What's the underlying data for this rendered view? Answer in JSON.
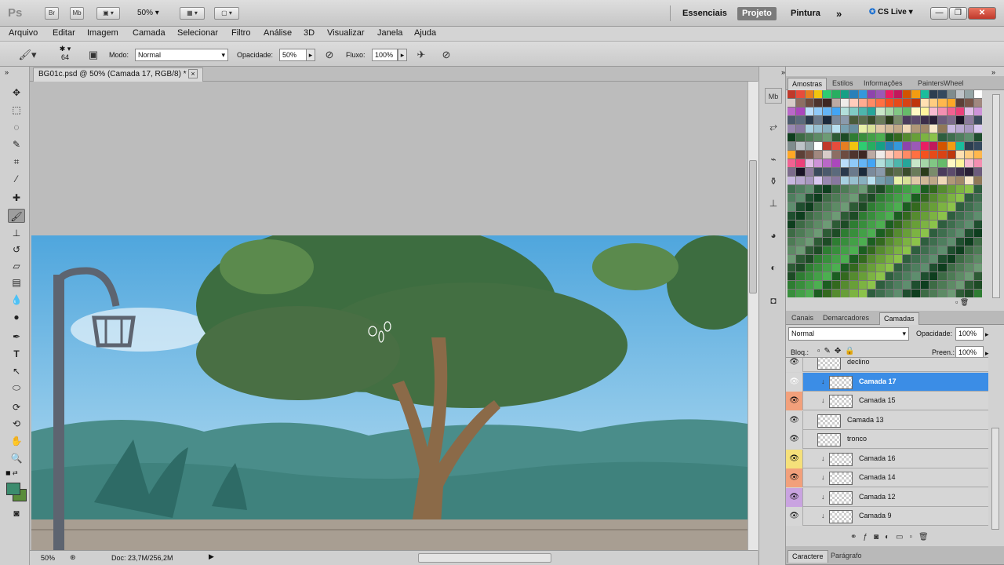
{
  "app": {
    "logo": "Ps",
    "br": "Br",
    "mb": "Mb",
    "zoom": "50%",
    "workspaces": [
      "Essenciais",
      "Projeto",
      "Pintura"
    ],
    "active_workspace": "Projeto",
    "more": "»",
    "cs_live": "CS Live"
  },
  "menu": [
    "Arquivo",
    "Editar",
    "Imagem",
    "Camada",
    "Selecionar",
    "Filtro",
    "Análise",
    "3D",
    "Visualizar",
    "Janela",
    "Ajuda"
  ],
  "options": {
    "brush_size": "64",
    "mode_label": "Modo:",
    "mode_value": "Normal",
    "opacity_label": "Opacidade:",
    "opacity_value": "50%",
    "flow_label": "Fluxo:",
    "flow_value": "100%"
  },
  "document": {
    "tab_title": "BG01c.psd @ 50% (Camada 17, RGB/8) *",
    "close": "×"
  },
  "status": {
    "zoom": "50%",
    "doc": "Doc: 23,7M/256,2M"
  },
  "swatch_panel": {
    "tabs": [
      "Amostras",
      "Estilos",
      "Informações",
      "PaintersWheel"
    ],
    "active": "Amostras"
  },
  "layers_panel": {
    "tabs": [
      "Canais",
      "Demarcadores",
      "Camadas"
    ],
    "active": "Camadas",
    "blend_mode": "Normal",
    "opacity_label": "Opacidade:",
    "opacity_value": "100%",
    "lock_label": "Bloq.:",
    "fill_label": "Preen.:",
    "fill_value": "100%",
    "layers": [
      {
        "name": "declino",
        "clipped": false,
        "eye_color": "#d6d6d6",
        "selected": false
      },
      {
        "name": "Camada 17",
        "clipped": true,
        "eye_color": "#d6d6d6",
        "selected": true
      },
      {
        "name": "Camada 15",
        "clipped": true,
        "eye_color": "#f2a07b",
        "selected": false
      },
      {
        "name": "Camada 13",
        "clipped": false,
        "eye_color": "#d6d6d6",
        "selected": false
      },
      {
        "name": "tronco",
        "clipped": false,
        "eye_color": "#d6d6d6",
        "selected": false
      },
      {
        "name": "Camada 16",
        "clipped": true,
        "eye_color": "#f5e07a",
        "selected": false
      },
      {
        "name": "Camada 14",
        "clipped": true,
        "eye_color": "#f2a07b",
        "selected": false
      },
      {
        "name": "Camada 12",
        "clipped": true,
        "eye_color": "#c9a3e0",
        "selected": false
      },
      {
        "name": "Camada 9",
        "clipped": true,
        "eye_color": "#d6d6d6",
        "selected": false
      }
    ]
  },
  "bottom_tabs": [
    "Caractere",
    "Parágrafo"
  ],
  "colors": {
    "foreground": "#3c8c6e",
    "background": "#5a8c3a"
  }
}
